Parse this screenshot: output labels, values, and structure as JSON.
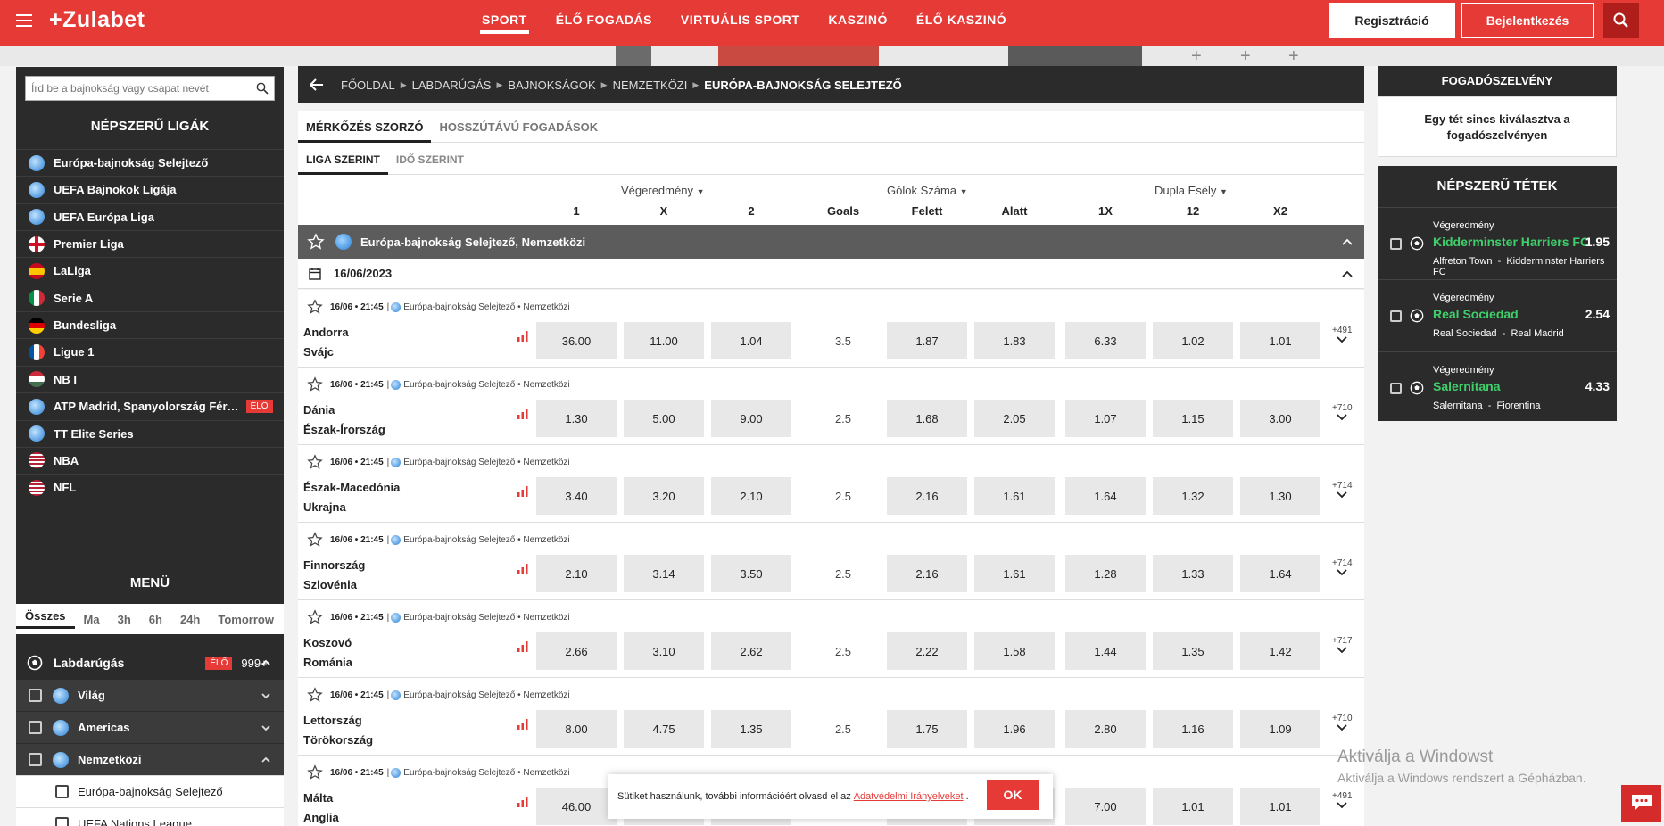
{
  "header": {
    "logo": "+Zulabet",
    "nav": [
      "SPORT",
      "ÉLŐ FOGADÁS",
      "VIRTUÁLIS SPORT",
      "KASZINÓ",
      "ÉLŐ KASZINÓ"
    ],
    "register": "Regisztráció",
    "login": "Bejelentkezés",
    "accent": "#e63a37"
  },
  "sidebar": {
    "search_placeholder": "Írd be a bajnokság vagy csapat nevét",
    "popular_title": "NÉPSZERŰ LIGÁK",
    "leagues": [
      {
        "label": "Európa-bajnokság Selejtező",
        "flag": "globe"
      },
      {
        "label": "UEFA Bajnokok Ligája",
        "flag": "globe"
      },
      {
        "label": "UEFA Európa Liga",
        "flag": "globe"
      },
      {
        "label": "Premier Liga",
        "flag": "england"
      },
      {
        "label": "LaLiga",
        "flag": "spain"
      },
      {
        "label": "Serie A",
        "flag": "italy"
      },
      {
        "label": "Bundesliga",
        "flag": "germany"
      },
      {
        "label": "Ligue 1",
        "flag": "france"
      },
      {
        "label": "NB I",
        "flag": "hungary"
      },
      {
        "label": "ATP Madrid, Spanyolország Fér…",
        "flag": "globe",
        "live": "ÉLŐ"
      },
      {
        "label": "TT Elite Series",
        "flag": "globe"
      },
      {
        "label": "NBA",
        "flag": "usa"
      },
      {
        "label": "NFL",
        "flag": "usa"
      }
    ],
    "menu_title": "MENÜ",
    "time_filters": [
      "Összes",
      "Ma",
      "3h",
      "6h",
      "24h",
      "Tomorrow"
    ],
    "sport": {
      "label": "Labdarúgás",
      "live": "ÉLŐ",
      "count": "999+"
    },
    "regions": [
      "Világ",
      "Americas",
      "Nemzetközi"
    ],
    "leaves": [
      "Európa-bajnokság Selejtező",
      "UEFA Nations League"
    ]
  },
  "breadcrumb": {
    "items": [
      "FŐOLDAL",
      "LABDARÚGÁS",
      "BAJNOKSÁGOK",
      "NEMZETKÖZI"
    ],
    "current": "EURÓPA-BAJNOKSÁG SELEJTEZŐ"
  },
  "tabs": {
    "primary": [
      "MÉRKŐZÉS SZORZÓ",
      "HOSSZÚTÁVÚ FOGADÁSOK"
    ],
    "secondary": [
      "LIGA SZERINT",
      "IDŐ SZERINT"
    ]
  },
  "columns": {
    "groups": [
      "Végeredmény",
      "Gólok Száma",
      "Dupla Esély"
    ],
    "labels": [
      "1",
      "X",
      "2",
      "Goals",
      "Felett",
      "Alatt",
      "1X",
      "12",
      "X2"
    ]
  },
  "league_bar": "Európa-bajnokság Selejtező, Nemzetközi",
  "date": "16/06/2023",
  "matches": [
    {
      "time": "16/06 • 21:45",
      "comp": "Európa-bajnokság Selejtező • Nemzetközi",
      "home": "Andorra",
      "away": "Svájc",
      "odds": [
        "36.00",
        "11.00",
        "1.04",
        "3.5",
        "1.87",
        "1.83",
        "6.33",
        "1.02",
        "1.01"
      ],
      "more": "+491"
    },
    {
      "time": "16/06 • 21:45",
      "comp": "Európa-bajnokság Selejtező • Nemzetközi",
      "home": "Dánia",
      "away": "Észak-Írország",
      "odds": [
        "1.30",
        "5.00",
        "9.00",
        "2.5",
        "1.68",
        "2.05",
        "1.07",
        "1.15",
        "3.00"
      ],
      "more": "+710"
    },
    {
      "time": "16/06 • 21:45",
      "comp": "Európa-bajnokság Selejtező • Nemzetközi",
      "home": "Észak-Macedónia",
      "away": "Ukrajna",
      "odds": [
        "3.40",
        "3.20",
        "2.10",
        "2.5",
        "2.16",
        "1.61",
        "1.64",
        "1.32",
        "1.30"
      ],
      "more": "+714"
    },
    {
      "time": "16/06 • 21:45",
      "comp": "Európa-bajnokság Selejtező • Nemzetközi",
      "home": "Finnország",
      "away": "Szlovénia",
      "odds": [
        "2.10",
        "3.14",
        "3.50",
        "2.5",
        "2.16",
        "1.61",
        "1.28",
        "1.33",
        "1.64"
      ],
      "more": "+714"
    },
    {
      "time": "16/06 • 21:45",
      "comp": "Európa-bajnokság Selejtező • Nemzetközi",
      "home": "Koszovó",
      "away": "Románia",
      "odds": [
        "2.66",
        "3.10",
        "2.62",
        "2.5",
        "2.22",
        "1.58",
        "1.44",
        "1.35",
        "1.42"
      ],
      "more": "+717"
    },
    {
      "time": "16/06 • 21:45",
      "comp": "Európa-bajnokság Selejtező • Nemzetközi",
      "home": "Lettország",
      "away": "Törökország",
      "odds": [
        "8.00",
        "4.75",
        "1.35",
        "2.5",
        "1.75",
        "1.96",
        "2.80",
        "1.16",
        "1.09"
      ],
      "more": "+710"
    },
    {
      "time": "16/06 • 21:45",
      "comp": "Európa-bajnokság Selejtező • Nemzetközi",
      "home": "Málta",
      "away": "Anglia",
      "odds": [
        "46.00",
        "",
        "",
        "",
        "",
        "",
        "7.00",
        "1.01",
        "1.01"
      ],
      "more": "+491"
    }
  ],
  "betslip": {
    "title": "FOGADÓSZELVÉNY",
    "empty": "Egy tét sincs kiválasztva a fogadószelvényen"
  },
  "popular_bets": {
    "title": "NÉPSZERŰ TÉTEK",
    "items": [
      {
        "kind": "Végeredmény",
        "pick": "Kidderminster Harriers FC",
        "odds": "1.95",
        "home": "Alfreton Town",
        "away": "Kidderminster Harriers FC"
      },
      {
        "kind": "Végeredmény",
        "pick": "Real Sociedad",
        "odds": "2.54",
        "home": "Real Sociedad",
        "away": "Real Madrid"
      },
      {
        "kind": "Végeredmény",
        "pick": "Salernitana",
        "odds": "4.33",
        "home": "Salernitana",
        "away": "Fiorentina"
      }
    ]
  },
  "cookie": {
    "text": "Sütiket használunk, további információért olvasd el az",
    "link": "Adatvédelmi Irányelveket",
    "ok": "OK"
  },
  "windows": {
    "line1": "Aktiválja a Windowst",
    "line2": "Aktiválja a Windows rendszert a Gépházban."
  }
}
